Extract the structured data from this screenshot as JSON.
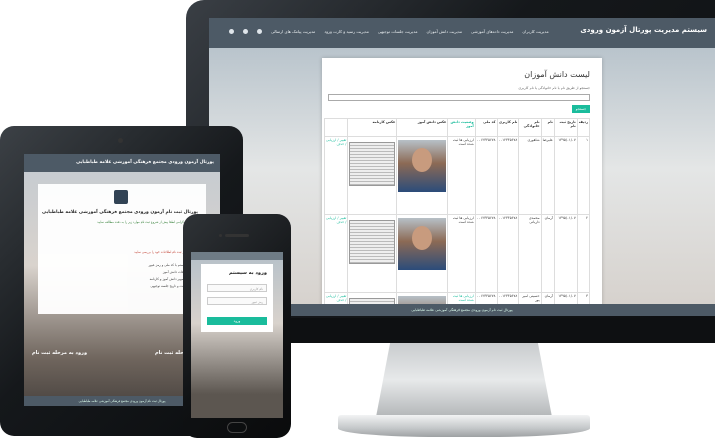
{
  "desktop": {
    "brand": "سیستم مدیریت پورتال آزمون ورودی",
    "nav": [
      "مدیریت کاربران",
      "مدیریت داده‌های آموزشی",
      "مدیریت دانش آموزان",
      "مدیریت جلسات توجیهی",
      "مدیریت رسید و کارت ورود",
      "مدیریت پیامک های ارسالی"
    ],
    "page_title": "لیست دانش آموزان",
    "search_hint": "جستجو از طریق نام یا نام خانوادگی یا نام کاربری",
    "search_button": "جستجو",
    "columns": [
      "ردیف",
      "تاریخ ثبت نام",
      "نام",
      "نام خانوادگی",
      "نام کاربری",
      "کد ملی",
      "وضعیت دانش آموز",
      "عکس دانش آموز",
      "عکس کارنامه"
    ],
    "rows": [
      {
        "index": "۱",
        "date": "۱۳۹۵/۰۱/۰۷",
        "first": "علیرضا",
        "last": "شاهوری",
        "user": "۰۰۱۲۳۴۵۶۷۸",
        "national": "۰۰۱۲۳۴۵۶۷۸",
        "status": "ارزیابی ها ثبت شده است",
        "action": "تغییر / ارزیابی / حذف"
      },
      {
        "index": "۲",
        "date": "۱۳۹۵/۰۱/۰۷",
        "first": "آرمان",
        "last": "محمدی داریانی",
        "user": "۰۰۱۲۳۴۵۶۷۸",
        "national": "۰۰۱۲۳۴۵۶۷۸",
        "status": "ارزیابی ها ثبت شده است",
        "action": "تغییر / ارزیابی / حذف"
      },
      {
        "index": "۳",
        "date": "۱۳۹۵/۰۱/۰۷",
        "first": "آرمان",
        "last": "حسینی امیر پور",
        "user": "۰۰۱۲۳۴۵۶۷۸",
        "national": "۰۰۱۲۳۴۵۶۷۸",
        "status": "ارزیابی ها ثبت شده است",
        "action": "تغییر / ارزیابی / حذف"
      }
    ],
    "footer": "پورتال ثبت نام آزمون ورودی مجتمع فرهنگی آموزشی علامه طباطبایی"
  },
  "tablet": {
    "header": "پورتال آزمون ورودی مجتمع فرهنگی آموزشی علامه طباطبایی",
    "card_title": "پورتال ثبت نام آزمون ورودی مجتمع فرهنگی آموزشی علامه طباطبایی",
    "card_text": "دانش آموز گرامی لطفا پیش از شروع ثبت نام موارد زیر را به دقت مطالعه نمایید",
    "warning": "لطفا پیش از ثبت نام اطلاعات خود را بررسی نمایید",
    "list": [
      "ورود به سیستم با کد ملی و رمز عبور",
      "تکمیل اطلاعات دانش آموز",
      "بارگذاری تصویر دانش آموز و کارنامه",
      "انتخاب ساعت و تاریخ جلسه توجیهی"
    ],
    "register_left": "ورود به مرحله ثبت نام",
    "register_right": "ورود به مرحله ثبت نام",
    "footer": "پورتال ثبت نام آزمون ورودی مجتمع فرهنگی آموزشی علامه طباطبایی"
  },
  "phone": {
    "title": "ورود به سیستم",
    "username_placeholder": "نام کاربری",
    "password_placeholder": "رمز عبور",
    "login_button": "ورود"
  }
}
